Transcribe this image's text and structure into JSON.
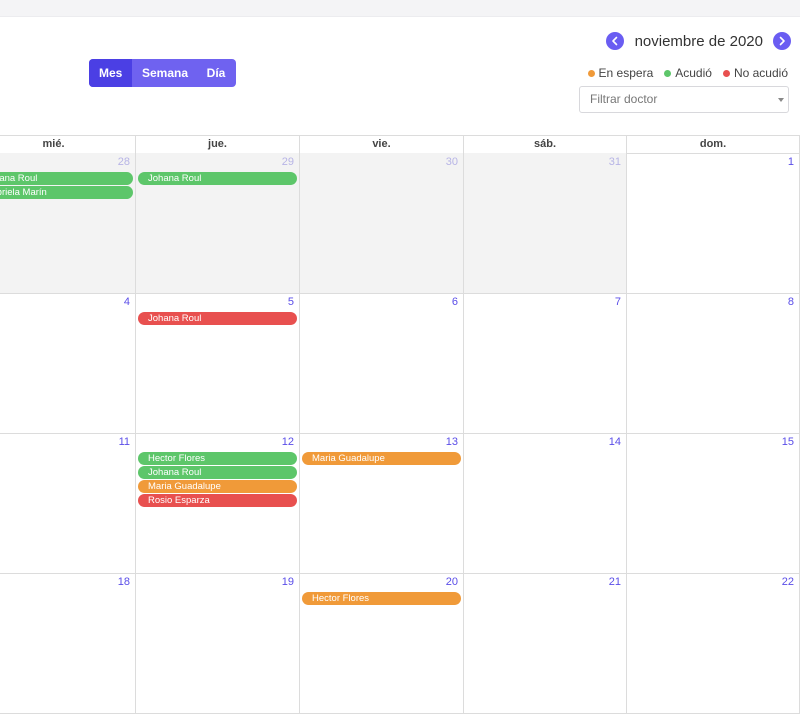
{
  "header": {
    "month_title": "noviembre de 2020",
    "views": [
      "Mes",
      "Semana",
      "Día"
    ],
    "active_view": "Mes"
  },
  "legend": [
    {
      "label": "En espera",
      "color": "#f09a39"
    },
    {
      "label": "Acudió",
      "color": "#5dc66a"
    },
    {
      "label": "No acudió",
      "color": "#e8504f"
    }
  ],
  "filter": {
    "placeholder": "Filtrar doctor"
  },
  "calendar": {
    "columns": [
      "mié.",
      "jue.",
      "vie.",
      "sáb.",
      "dom."
    ],
    "weeks": [
      {
        "days": [
          {
            "num": "28",
            "other": true,
            "events": [
              {
                "label": "Johana Roul",
                "status": "acudio"
              },
              {
                "label": "Gabriela Marín",
                "status": "acudio"
              }
            ]
          },
          {
            "num": "29",
            "other": true,
            "events": [
              {
                "label": "Johana Roul",
                "status": "acudio"
              }
            ]
          },
          {
            "num": "30",
            "other": true,
            "events": []
          },
          {
            "num": "31",
            "other": true,
            "events": []
          },
          {
            "num": "1",
            "other": false,
            "events": []
          }
        ]
      },
      {
        "days": [
          {
            "num": "4",
            "other": false,
            "events": []
          },
          {
            "num": "5",
            "other": false,
            "events": [
              {
                "label": "Johana Roul",
                "status": "no_acudio"
              }
            ]
          },
          {
            "num": "6",
            "other": false,
            "events": []
          },
          {
            "num": "7",
            "other": false,
            "events": []
          },
          {
            "num": "8",
            "other": false,
            "events": []
          }
        ]
      },
      {
        "days": [
          {
            "num": "11",
            "other": false,
            "events": []
          },
          {
            "num": "12",
            "other": false,
            "events": [
              {
                "label": "Hector Flores",
                "status": "acudio"
              },
              {
                "label": "Johana Roul",
                "status": "acudio"
              },
              {
                "label": "Maria Guadalupe",
                "status": "en_espera"
              },
              {
                "label": "Rosio Esparza",
                "status": "no_acudio"
              }
            ]
          },
          {
            "num": "13",
            "other": false,
            "events": [
              {
                "label": "Maria Guadalupe",
                "status": "en_espera"
              }
            ]
          },
          {
            "num": "14",
            "other": false,
            "events": []
          },
          {
            "num": "15",
            "other": false,
            "events": []
          }
        ]
      },
      {
        "days": [
          {
            "num": "18",
            "other": false,
            "events": []
          },
          {
            "num": "19",
            "other": false,
            "events": []
          },
          {
            "num": "20",
            "other": false,
            "events": [
              {
                "label": "Hector Flores",
                "status": "en_espera"
              }
            ]
          },
          {
            "num": "21",
            "other": false,
            "events": []
          },
          {
            "num": "22",
            "other": false,
            "events": []
          }
        ]
      }
    ]
  }
}
